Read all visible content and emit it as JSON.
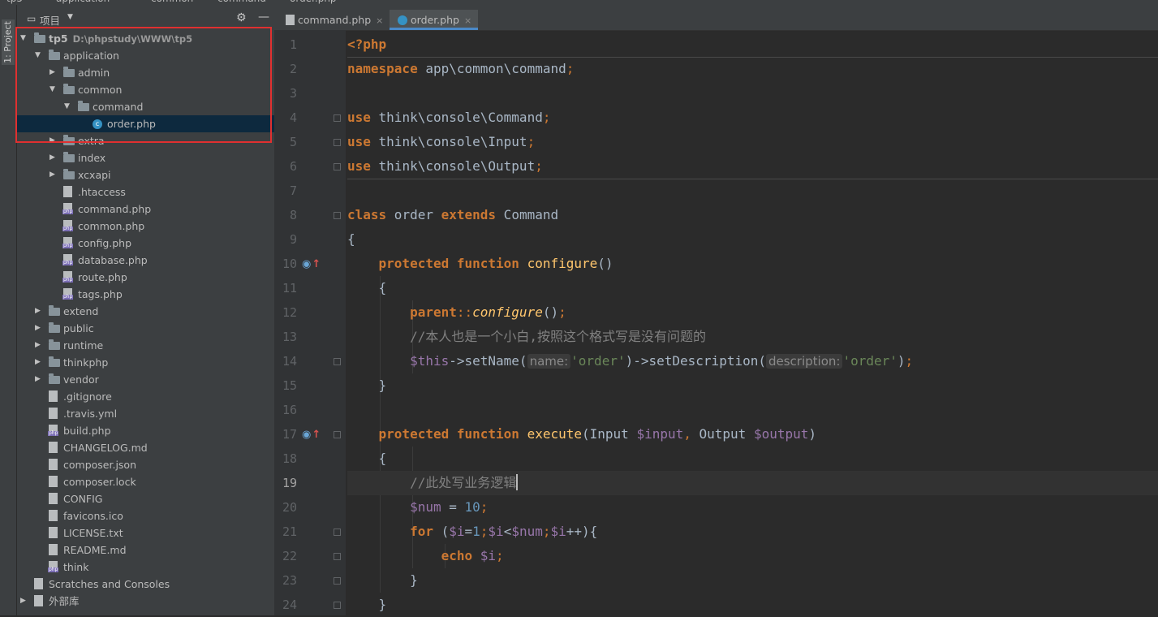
{
  "breadcrumbs": [
    "tp5",
    "application",
    "common",
    "command",
    "order.php"
  ],
  "sidebar": {
    "stripe_label": "1: Project",
    "header_title": "项目",
    "tree": [
      {
        "label": "tp5",
        "path": "D:\\phpstudy\\WWW\\tp5",
        "arrow": "▼",
        "icon": "folder-icon",
        "indent": 0,
        "bold": true
      },
      {
        "label": "application",
        "arrow": "▼",
        "icon": "folder-icon",
        "indent": 1
      },
      {
        "label": "admin",
        "arrow": "▶",
        "icon": "folder-icon",
        "indent": 2
      },
      {
        "label": "common",
        "arrow": "▼",
        "icon": "folder-icon",
        "indent": 2
      },
      {
        "label": "command",
        "arrow": "▼",
        "icon": "folder-icon",
        "indent": 3
      },
      {
        "label": "order.php",
        "arrow": "",
        "icon": "php-class-icon",
        "indent": 4,
        "selected": true
      },
      {
        "label": "extra",
        "arrow": "▶",
        "icon": "folder-icon",
        "indent": 2
      },
      {
        "label": "index",
        "arrow": "▶",
        "icon": "folder-icon",
        "indent": 2
      },
      {
        "label": "xcxapi",
        "arrow": "▶",
        "icon": "folder-icon",
        "indent": 2
      },
      {
        "label": ".htaccess",
        "arrow": "",
        "icon": "file-icon",
        "indent": 2
      },
      {
        "label": "command.php",
        "arrow": "",
        "icon": "php-file-icon",
        "indent": 2
      },
      {
        "label": "common.php",
        "arrow": "",
        "icon": "php-file-icon",
        "indent": 2
      },
      {
        "label": "config.php",
        "arrow": "",
        "icon": "php-file-icon",
        "indent": 2
      },
      {
        "label": "database.php",
        "arrow": "",
        "icon": "php-file-icon",
        "indent": 2
      },
      {
        "label": "route.php",
        "arrow": "",
        "icon": "php-file-icon",
        "indent": 2
      },
      {
        "label": "tags.php",
        "arrow": "",
        "icon": "php-file-icon",
        "indent": 2
      },
      {
        "label": "extend",
        "arrow": "▶",
        "icon": "folder-icon",
        "indent": 1
      },
      {
        "label": "public",
        "arrow": "▶",
        "icon": "folder-icon",
        "indent": 1
      },
      {
        "label": "runtime",
        "arrow": "▶",
        "icon": "folder-icon",
        "indent": 1
      },
      {
        "label": "thinkphp",
        "arrow": "▶",
        "icon": "folder-icon",
        "indent": 1
      },
      {
        "label": "vendor",
        "arrow": "▶",
        "icon": "folder-icon",
        "indent": 1
      },
      {
        "label": ".gitignore",
        "arrow": "",
        "icon": "file-icon",
        "indent": 1
      },
      {
        "label": ".travis.yml",
        "arrow": "",
        "icon": "file-icon",
        "indent": 1
      },
      {
        "label": "build.php",
        "arrow": "",
        "icon": "php-file-icon",
        "indent": 1
      },
      {
        "label": "CHANGELOG.md",
        "arrow": "",
        "icon": "file-icon",
        "indent": 1
      },
      {
        "label": "composer.json",
        "arrow": "",
        "icon": "file-icon",
        "indent": 1
      },
      {
        "label": "composer.lock",
        "arrow": "",
        "icon": "file-icon",
        "indent": 1
      },
      {
        "label": "CONFIG",
        "arrow": "",
        "icon": "file-icon",
        "indent": 1
      },
      {
        "label": "favicons.ico",
        "arrow": "",
        "icon": "file-icon",
        "indent": 1
      },
      {
        "label": "LICENSE.txt",
        "arrow": "",
        "icon": "file-icon",
        "indent": 1
      },
      {
        "label": "README.md",
        "arrow": "",
        "icon": "file-icon",
        "indent": 1
      },
      {
        "label": "think",
        "arrow": "",
        "icon": "php-file-icon",
        "indent": 1
      },
      {
        "label": "Scratches and Consoles",
        "arrow": "",
        "icon": "scratches-icon",
        "indent": 0
      },
      {
        "label": "外部库",
        "arrow": "▶",
        "icon": "library-icon",
        "indent": 0
      }
    ]
  },
  "editor": {
    "tabs": [
      {
        "label": "command.php",
        "icon": "php-file-icon",
        "active": false
      },
      {
        "label": "order.php",
        "icon": "php-class-icon",
        "active": true
      }
    ],
    "current_line": 19,
    "code_lines": [
      [
        {
          "t": "<?php",
          "c": "kw"
        }
      ],
      [
        {
          "t": "namespace",
          "c": "kw"
        },
        {
          "t": " app\\common\\command"
        },
        {
          "t": ";",
          "c": "pun"
        }
      ],
      [],
      [
        {
          "t": "use",
          "c": "kw"
        },
        {
          "t": " think\\console\\Command"
        },
        {
          "t": ";",
          "c": "pun"
        }
      ],
      [
        {
          "t": "use",
          "c": "kw"
        },
        {
          "t": " think\\console\\Input"
        },
        {
          "t": ";",
          "c": "pun"
        }
      ],
      [
        {
          "t": "use",
          "c": "kw"
        },
        {
          "t": " think\\console\\Output"
        },
        {
          "t": ";",
          "c": "pun"
        }
      ],
      [],
      [
        {
          "t": "class",
          "c": "kw"
        },
        {
          "t": " order "
        },
        {
          "t": "extends",
          "c": "kw"
        },
        {
          "t": " Command"
        }
      ],
      [
        {
          "t": "{"
        }
      ],
      [
        {
          "t": "    "
        },
        {
          "t": "protected",
          "c": "kw"
        },
        {
          "t": " "
        },
        {
          "t": "function",
          "c": "kw"
        },
        {
          "t": " "
        },
        {
          "t": "configure",
          "c": "fn"
        },
        {
          "t": "()"
        }
      ],
      [
        {
          "t": "    {"
        }
      ],
      [
        {
          "t": "        "
        },
        {
          "t": "parent",
          "c": "kw"
        },
        {
          "t": "::",
          "c": "pun"
        },
        {
          "t": "configure",
          "c": "it"
        },
        {
          "t": "()"
        },
        {
          "t": ";",
          "c": "pun"
        }
      ],
      [
        {
          "t": "        "
        },
        {
          "t": "//本人也是一个小白,按照这个格式写是没有问题的",
          "c": "cmt"
        }
      ],
      [
        {
          "t": "        "
        },
        {
          "t": "$this",
          "c": "var"
        },
        {
          "t": "->setName("
        },
        {
          "t": "name:",
          "c": "hint"
        },
        {
          "t": "'order'",
          "c": "str"
        },
        {
          "t": ")->setDescription("
        },
        {
          "t": "description:",
          "c": "hint"
        },
        {
          "t": "'order'",
          "c": "str"
        },
        {
          "t": ")"
        },
        {
          "t": ";",
          "c": "pun"
        }
      ],
      [
        {
          "t": "    }"
        }
      ],
      [],
      [
        {
          "t": "    "
        },
        {
          "t": "protected",
          "c": "kw"
        },
        {
          "t": " "
        },
        {
          "t": "function",
          "c": "kw"
        },
        {
          "t": " "
        },
        {
          "t": "execute",
          "c": "fn"
        },
        {
          "t": "(Input "
        },
        {
          "t": "$input",
          "c": "var"
        },
        {
          "t": ", ",
          "c": "pun"
        },
        {
          "t": "Output "
        },
        {
          "t": "$output",
          "c": "var"
        },
        {
          "t": ")"
        }
      ],
      [
        {
          "t": "    {"
        }
      ],
      [
        {
          "t": "        "
        },
        {
          "t": "//此处写业务逻辑",
          "c": "cmt"
        },
        {
          "t": "",
          "c": "caret"
        }
      ],
      [
        {
          "t": "        "
        },
        {
          "t": "$num",
          "c": "var"
        },
        {
          "t": " = "
        },
        {
          "t": "10",
          "c": "num"
        },
        {
          "t": ";",
          "c": "pun"
        }
      ],
      [
        {
          "t": "        "
        },
        {
          "t": "for",
          "c": "kw"
        },
        {
          "t": " ("
        },
        {
          "t": "$i",
          "c": "var"
        },
        {
          "t": "="
        },
        {
          "t": "1",
          "c": "num"
        },
        {
          "t": ";",
          "c": "pun"
        },
        {
          "t": "$i",
          "c": "var"
        },
        {
          "t": "<"
        },
        {
          "t": "$num",
          "c": "var"
        },
        {
          "t": ";",
          "c": "pun"
        },
        {
          "t": "$i",
          "c": "var"
        },
        {
          "t": "++){"
        }
      ],
      [
        {
          "t": "            "
        },
        {
          "t": "echo",
          "c": "kw"
        },
        {
          "t": " "
        },
        {
          "t": "$i",
          "c": "var"
        },
        {
          "t": ";",
          "c": "pun"
        }
      ],
      [
        {
          "t": "        }"
        }
      ],
      [
        {
          "t": "    }"
        }
      ]
    ],
    "gutter_marks": [
      10,
      17
    ],
    "fold_lines": [
      4,
      5,
      6,
      8,
      14,
      17,
      21,
      22,
      23,
      24
    ]
  },
  "colors": {
    "accent": "#4a88c7",
    "selection": "#0d293e",
    "highlight_box": "#e03030",
    "keyword": "#cc7832",
    "string": "#6a8759",
    "comment": "#808080"
  }
}
